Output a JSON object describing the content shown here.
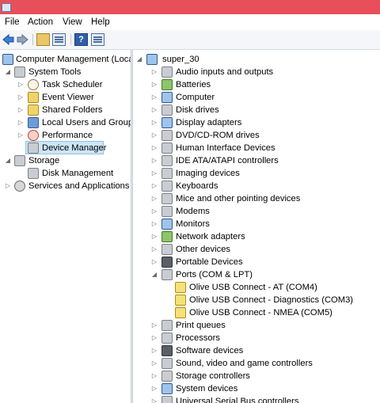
{
  "menu": {
    "file": "File",
    "action": "Action",
    "view": "View",
    "help": "Help"
  },
  "toolbar": {
    "help_glyph": "?"
  },
  "left_tree": {
    "root": "Computer Management (Local",
    "system_tools": "System Tools",
    "task_scheduler": "Task Scheduler",
    "event_viewer": "Event Viewer",
    "shared_folders": "Shared Folders",
    "local_users": "Local Users and Groups",
    "performance": "Performance",
    "device_manager": "Device Manager",
    "storage": "Storage",
    "disk_management": "Disk Management",
    "services": "Services and Applications"
  },
  "device_tree": {
    "root": "super_30",
    "categories": [
      "Audio inputs and outputs",
      "Batteries",
      "Computer",
      "Disk drives",
      "Display adapters",
      "DVD/CD-ROM drives",
      "Human Interface Devices",
      "IDE ATA/ATAPI controllers",
      "Imaging devices",
      "Keyboards",
      "Mice and other pointing devices",
      "Modems",
      "Monitors",
      "Network adapters",
      "Other devices",
      "Portable Devices",
      "Ports (COM & LPT)"
    ],
    "ports_children": [
      "Olive USB Connect - AT (COM4)",
      "Olive USB Connect - Diagnostics (COM3)",
      "Olive USB Connect - NMEA (COM5)"
    ],
    "after_ports": [
      "Print queues",
      "Processors",
      "Software devices",
      "Sound, video and game controllers",
      "Storage controllers",
      "System devices",
      "Universal Serial Bus controllers"
    ]
  },
  "colors": {
    "titlebar": "#e94f5a",
    "selection": "#cde6f7"
  }
}
